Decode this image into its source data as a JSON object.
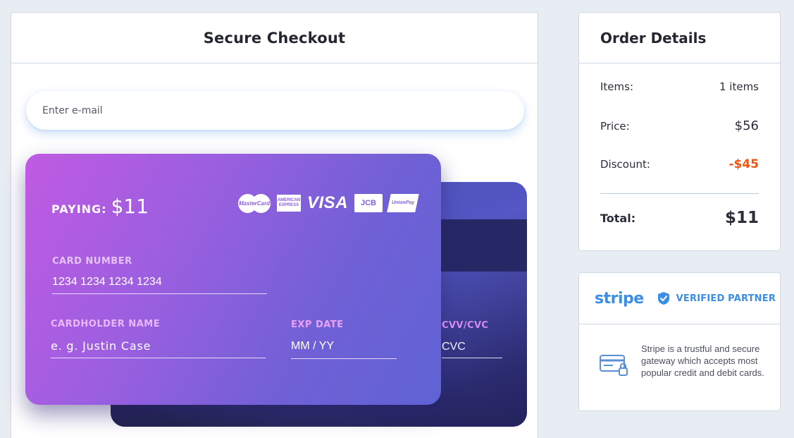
{
  "checkout": {
    "title": "Secure Checkout",
    "email_placeholder": "Enter e-mail"
  },
  "card": {
    "paying_label": "PAYING:",
    "paying_amount": "$11",
    "brands": [
      "MasterCard",
      "AMERICAN EXPRESS",
      "VISA",
      "JCB",
      "UnionPay"
    ],
    "number_label": "CARD NUMBER",
    "number_placeholder": "1234 1234 1234 1234",
    "name_label": "CARDHOLDER NAME",
    "name_placeholder": "e. g. Justin Case",
    "exp_label": "EXP DATE",
    "exp_placeholder": "MM / YY",
    "cvv_label": "CVV/CVC",
    "cvv_placeholder": "CVC"
  },
  "order": {
    "title": "Order Details",
    "items_label": "Items:",
    "items_value": "1 items",
    "price_label": "Price:",
    "price_value": "$56",
    "discount_label": "Discount:",
    "discount_value": "-$45",
    "total_label": "Total:",
    "total_value": "$11"
  },
  "stripe": {
    "logo_text": "stripe",
    "verified_text": "VERIFIED PARTNER",
    "description": "Stripe is a trustful and secure gateway which accepts most popular credit and debit cards."
  },
  "colors": {
    "accent_blue": "#3a8ee6",
    "discount_orange": "#f2540d",
    "card_gradient_start": "#c05ae3",
    "card_gradient_end": "#5f63d4"
  }
}
